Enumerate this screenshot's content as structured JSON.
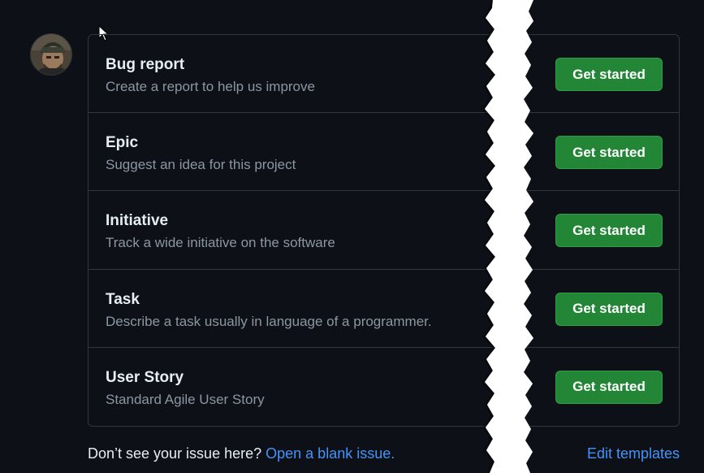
{
  "templates": [
    {
      "name": "Bug report",
      "description": "Create a report to help us improve",
      "button": "Get started"
    },
    {
      "name": "Epic",
      "description": "Suggest an idea for this project",
      "button": "Get started"
    },
    {
      "name": "Initiative",
      "description": "Track a wide initiative on the software",
      "button": "Get started"
    },
    {
      "name": "Task",
      "description": "Describe a task usually in language of a programmer.",
      "button": "Get started"
    },
    {
      "name": "User Story",
      "description": "Standard Agile User Story",
      "button": "Get started"
    }
  ],
  "footer": {
    "prompt": "Don’t see your issue here?",
    "blank_issue_link": "Open a blank issue.",
    "edit_templates_link": "Edit templates"
  },
  "colors": {
    "background": "#0d1117",
    "border": "#30363d",
    "button_green": "#238636",
    "link_blue": "#4493f8",
    "muted_text": "#8d96a0"
  },
  "icons": {
    "avatar": "user-avatar",
    "cursor": "mouse-pointer-icon"
  }
}
